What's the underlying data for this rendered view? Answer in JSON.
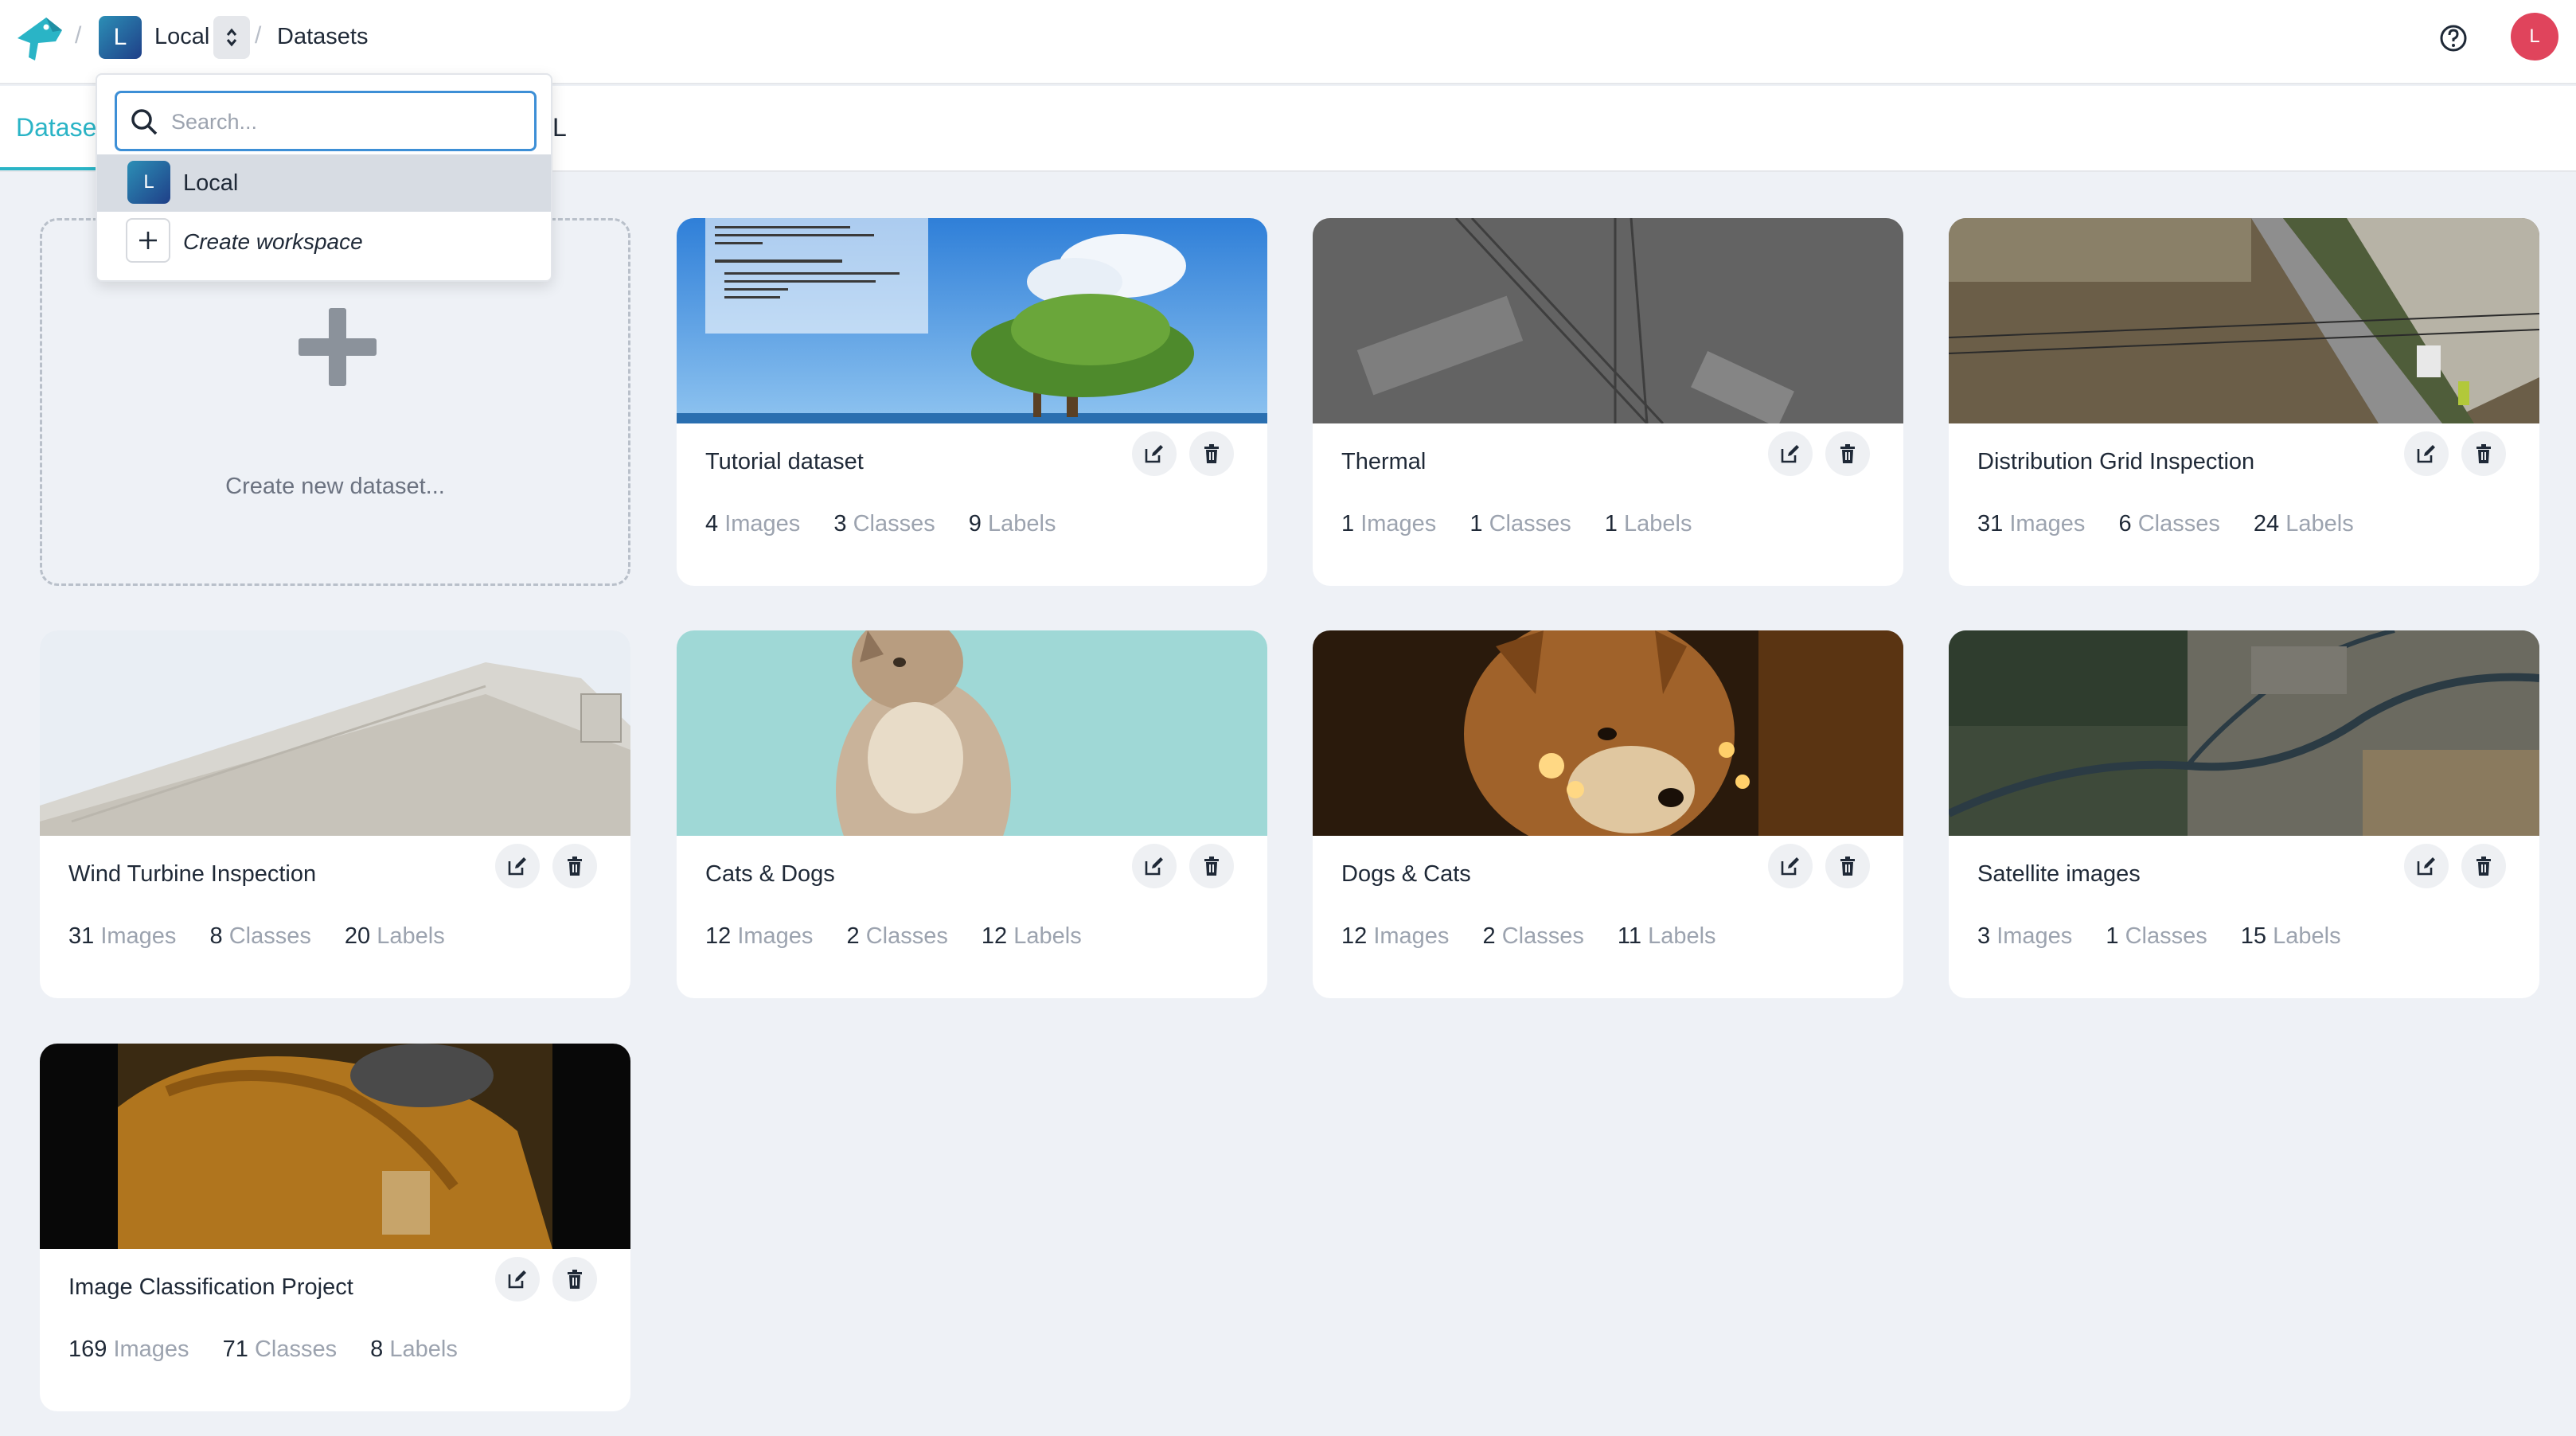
{
  "breadcrumb": {
    "separator": "/",
    "workspace_initial": "L",
    "workspace_name": "Local",
    "page": "Datasets"
  },
  "header": {
    "help_icon": "help-circle-icon",
    "avatar_initial": "L"
  },
  "tabs": {
    "active_label": "Datase",
    "other_label": "L"
  },
  "create_card": {
    "label": "Create new dataset..."
  },
  "workspace_dropdown": {
    "search_placeholder": "Search...",
    "items": [
      {
        "initial": "L",
        "label": "Local"
      },
      {
        "label": "Create workspace"
      }
    ]
  },
  "stat_labels": {
    "images": "Images",
    "classes": "Classes",
    "labels": "Labels"
  },
  "datasets": [
    {
      "title": "Tutorial dataset",
      "images": "4",
      "classes": "3",
      "labels": "9",
      "thumb": "tree-on-beach-with-instructions"
    },
    {
      "title": "Thermal",
      "images": "1",
      "classes": "1",
      "labels": "1",
      "thumb": "grayscale-power-lines"
    },
    {
      "title": "Distribution Grid Inspection",
      "images": "31",
      "classes": "6",
      "labels": "24",
      "thumb": "aerial-road-utility-poles"
    },
    {
      "title": "Wind Turbine Inspection",
      "images": "31",
      "classes": "8",
      "labels": "20",
      "thumb": "wind-turbine-blade"
    },
    {
      "title": "Cats & Dogs",
      "images": "12",
      "classes": "2",
      "labels": "12",
      "thumb": "kitten-teal-background"
    },
    {
      "title": "Dogs & Cats",
      "images": "12",
      "classes": "2",
      "labels": "11",
      "thumb": "shiba-dog-lights"
    },
    {
      "title": "Satellite images",
      "images": "3",
      "classes": "1",
      "labels": "15",
      "thumb": "satellite-city-river"
    },
    {
      "title": "Image Classification Project",
      "images": "169",
      "classes": "71",
      "labels": "8",
      "thumb": "painting-key"
    }
  ],
  "colors": {
    "accent": "#2ab4c6",
    "page_bg": "#eef1f6",
    "avatar": "#e0445c",
    "workspace_badge": "#1f3f88"
  }
}
